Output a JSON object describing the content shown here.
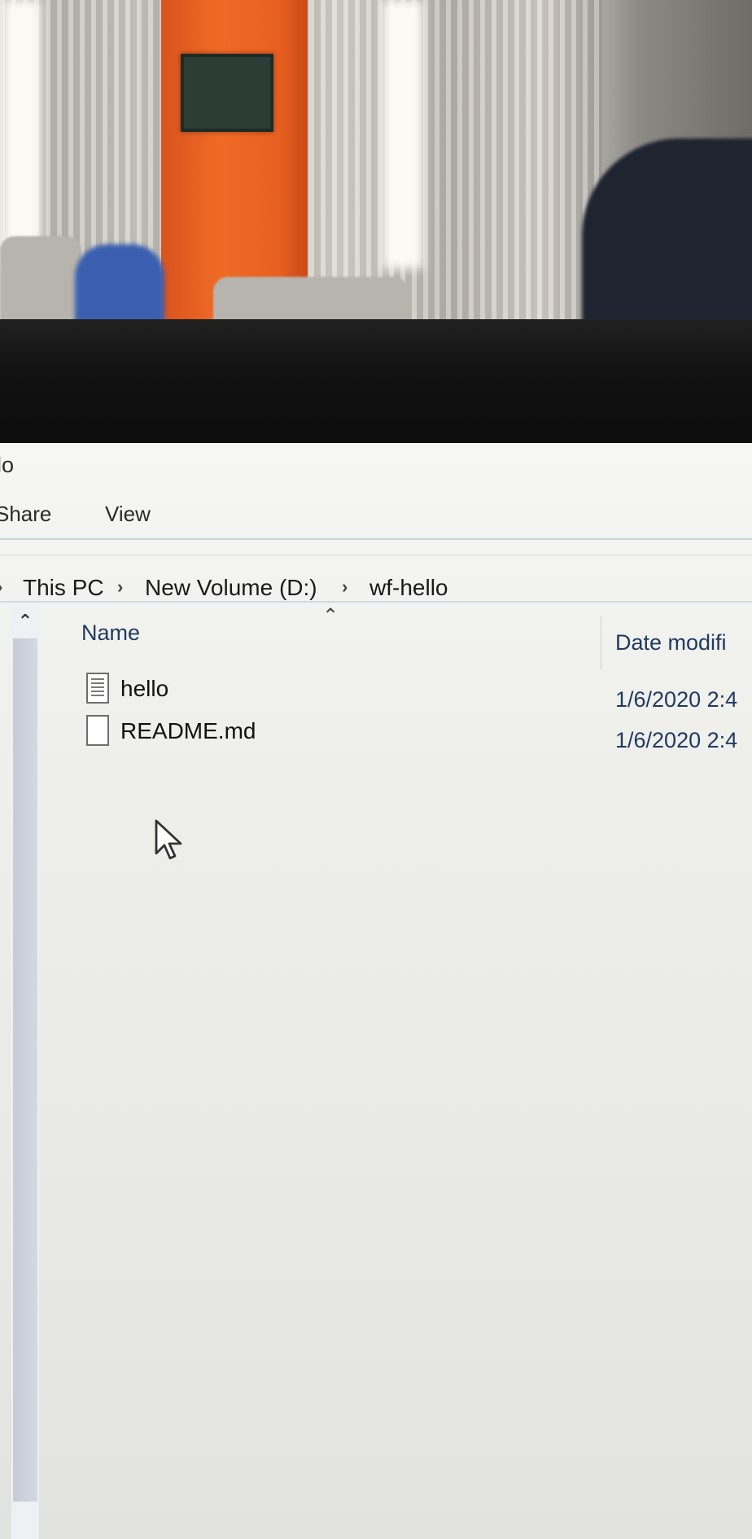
{
  "window": {
    "title": "llo"
  },
  "ribbon": {
    "tabs": [
      {
        "label": "Share"
      },
      {
        "label": "View"
      }
    ]
  },
  "address_bar": {
    "separator_glyph": "›",
    "crumbs": [
      {
        "label": "This PC"
      },
      {
        "label": "New Volume (D:)"
      },
      {
        "label": "wf-hello"
      }
    ]
  },
  "columns": {
    "name": "Name",
    "date_modified": "Date modifi"
  },
  "files": [
    {
      "name": "hello",
      "date_modified": "1/6/2020 2:4",
      "icon": "text-file-icon"
    },
    {
      "name": "README.md",
      "date_modified": "1/6/2020 2:4",
      "icon": "blank-file-icon"
    }
  ]
}
